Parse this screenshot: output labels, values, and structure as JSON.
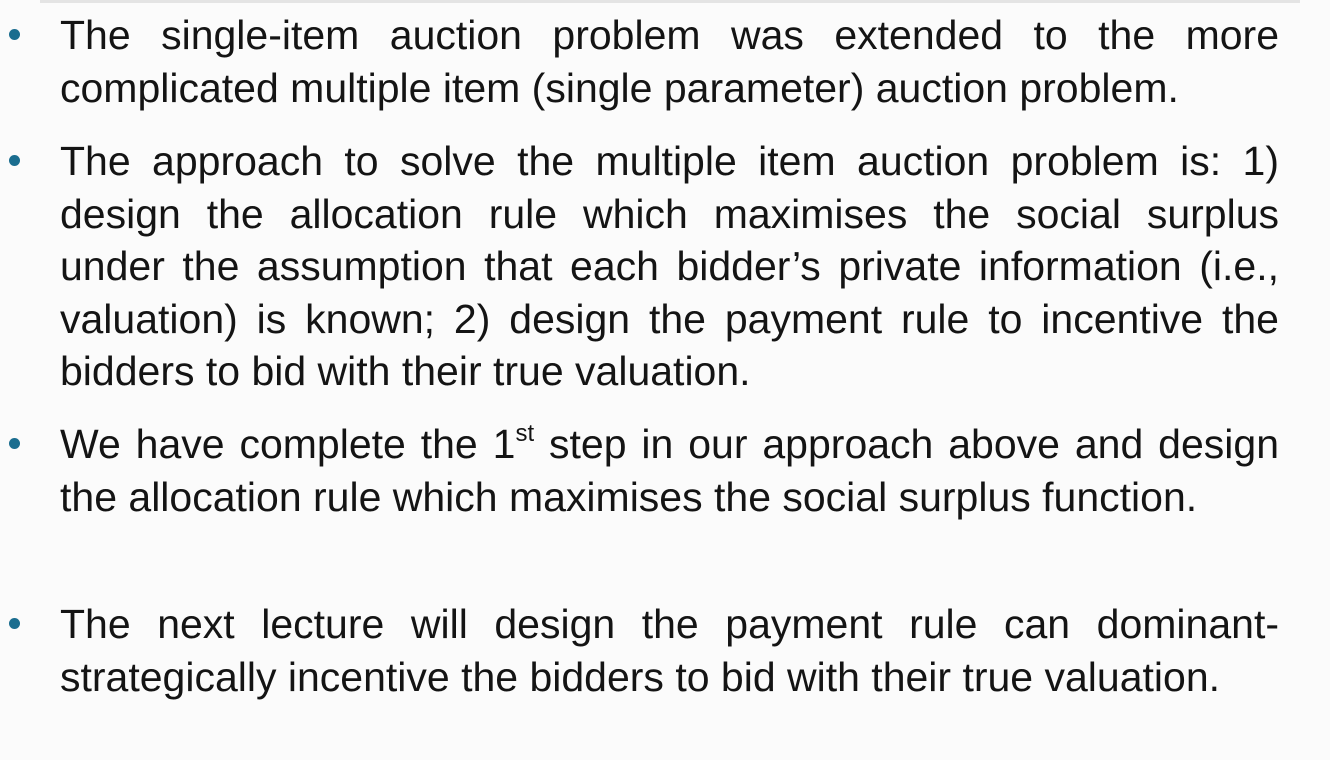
{
  "slide": {
    "bullets": [
      {
        "text": "The single-item auction problem was extended to the more complicated multiple item (single parameter) auction problem."
      },
      {
        "text": "The approach to solve the multiple item auction problem is: 1) design the allocation rule which maximises the social surplus under the assumption that each bidder’s private information (i.e., valuation) is known; 2) design the payment rule to incentive the bidders to bid with their true valuation."
      },
      {
        "text_before": "We have complete the 1",
        "superscript": "st",
        "text_after": " step in our approach above and design the allocation rule which maximises the social surplus function."
      },
      {
        "text": "The next lecture will design the payment rule can dominant-strategically incentive the bidders to bid with their true valuation."
      }
    ],
    "bullet_color": "#1a6d8f"
  }
}
